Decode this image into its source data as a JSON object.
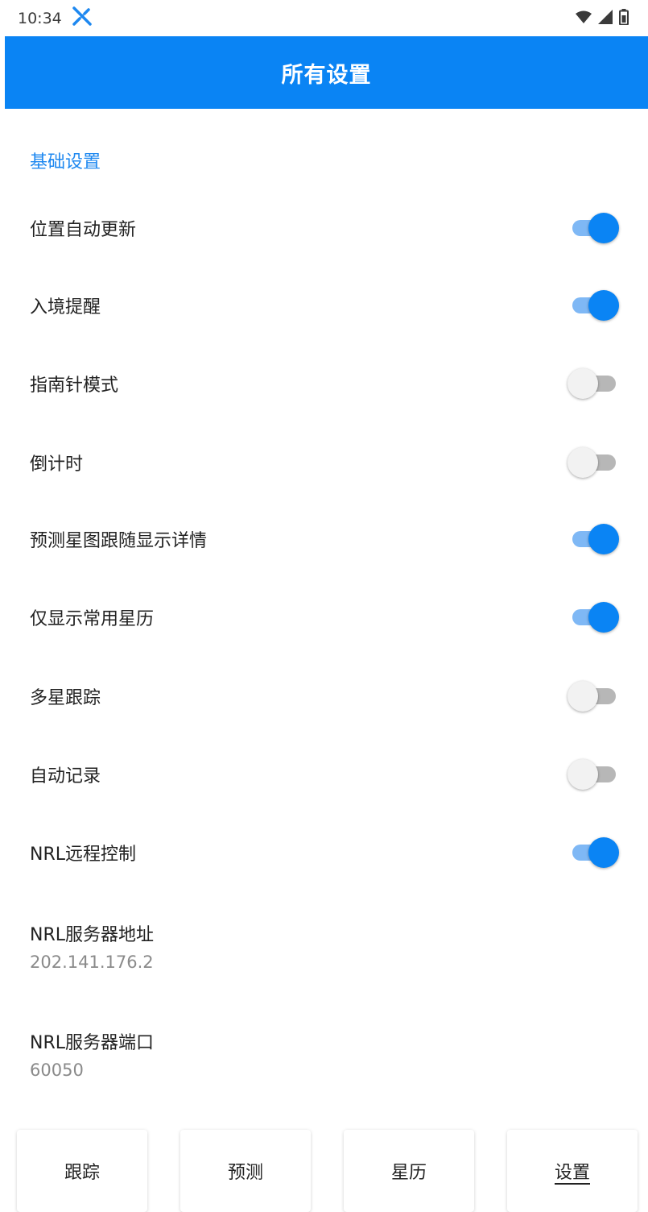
{
  "status_bar": {
    "time": "10:34",
    "notification_icon": "satellite-icon",
    "indicators": [
      "wifi-icon",
      "signal-icon",
      "battery-icon"
    ]
  },
  "app_bar": {
    "title": "所有设置"
  },
  "section": {
    "header": "基础设置"
  },
  "toggles": [
    {
      "label": "位置自动更新",
      "checked": true
    },
    {
      "label": "入境提醒",
      "checked": true
    },
    {
      "label": "指南针模式",
      "checked": false
    },
    {
      "label": "倒计时",
      "checked": false
    },
    {
      "label": "预测星图跟随显示详情",
      "checked": true
    },
    {
      "label": "仅显示常用星历",
      "checked": true
    },
    {
      "label": "多星跟踪",
      "checked": false
    },
    {
      "label": "自动记录",
      "checked": false
    },
    {
      "label": "NRL远程控制",
      "checked": true
    }
  ],
  "server": {
    "address_label": "NRL服务器地址",
    "address_value": "202.141.176.2",
    "port_label": "NRL服务器端口",
    "port_value": "60050"
  },
  "bottom_nav": {
    "items": [
      {
        "label": "跟踪",
        "active": false
      },
      {
        "label": "预测",
        "active": false
      },
      {
        "label": "星历",
        "active": false
      },
      {
        "label": "设置",
        "active": true
      }
    ]
  },
  "colors": {
    "accent": "#0a84f4",
    "section_header": "#1e88f0",
    "switch_on_track": "#7fb8f5",
    "switch_off_track": "#b7b7b7"
  }
}
